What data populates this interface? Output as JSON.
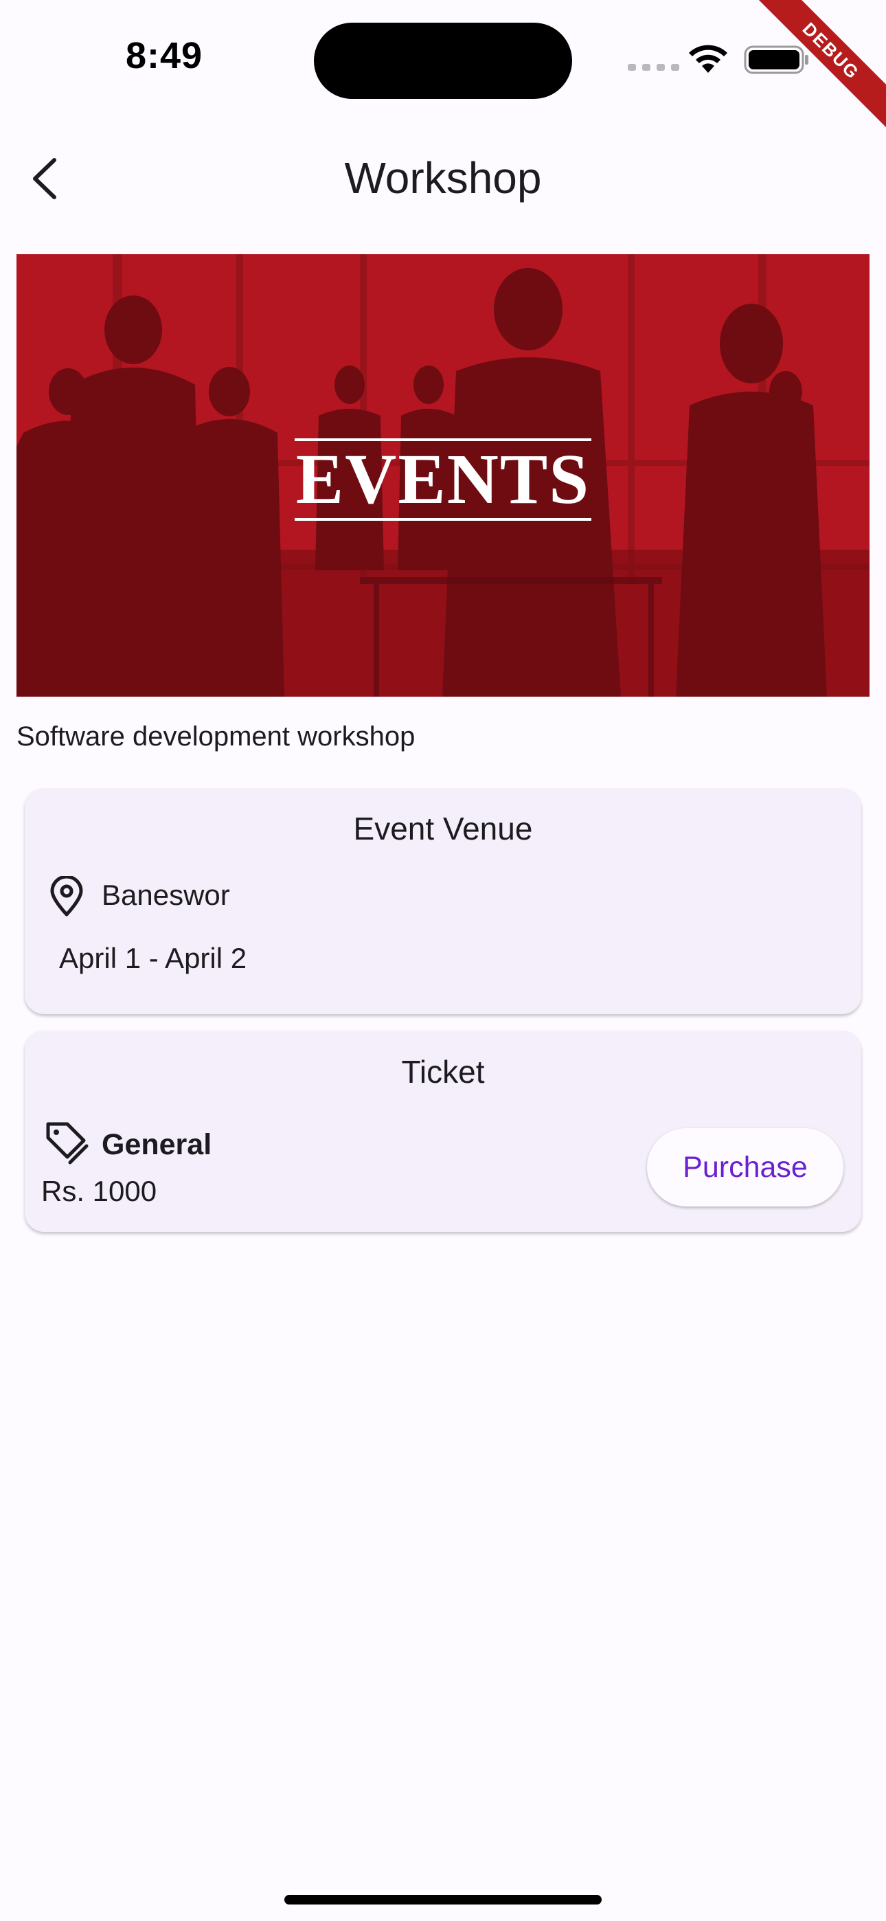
{
  "status_bar": {
    "time": "8:49",
    "debug_label": "DEBUG"
  },
  "app_bar": {
    "title": "Workshop",
    "back_icon": "chevron-left-icon"
  },
  "banner": {
    "text": "EVENTS",
    "background_color": "#b31620"
  },
  "event": {
    "description": "Software development workshop"
  },
  "venue_card": {
    "title": "Event Venue",
    "location_icon": "location-pin-icon",
    "location": "Baneswor",
    "dates": "April 1 - April 2"
  },
  "ticket_card": {
    "title": "Ticket",
    "tag_icon": "tag-icon",
    "ticket_type": "General",
    "price": "Rs. 1000",
    "purchase_label": "Purchase"
  },
  "colors": {
    "accent": "#6a1fd0",
    "card_background": "#f4effa",
    "page_background": "#fdfbff"
  }
}
